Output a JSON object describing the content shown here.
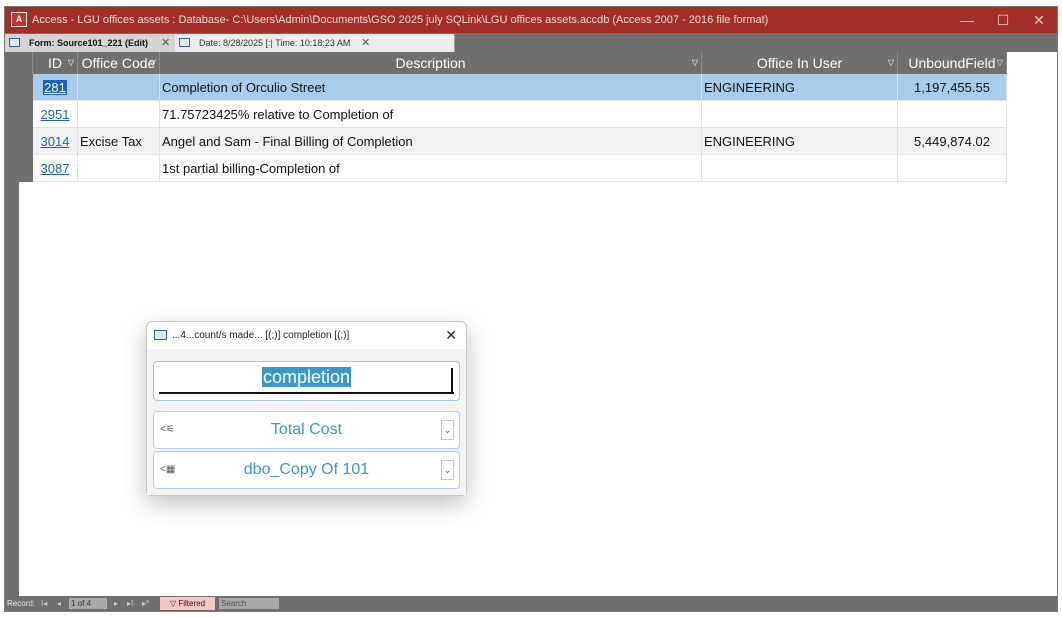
{
  "window": {
    "app_icon_text": "A",
    "title": "Access - LGU offices assets : Database- C:\\Users\\Admin\\Documents\\GSO 2025 july SQLink\\LGU offices assets.accdb (Access 2007 - 2016 file format)",
    "minimize": "—",
    "maximize": "☐",
    "close": "✕"
  },
  "tabs": [
    {
      "label": "Form: Source101_221 (Edit)",
      "close": "✕"
    },
    {
      "label": "Date: 8/28/2025 [:| Time: 10:18:23 AM",
      "close": "✕"
    }
  ],
  "columns": [
    {
      "label": "ID",
      "dropdown": "▽"
    },
    {
      "label": "Office Code",
      "dropdown": "▽"
    },
    {
      "label": "Description",
      "dropdown": "▽"
    },
    {
      "label": "Office In User",
      "dropdown": "▽"
    },
    {
      "label": "UnboundField",
      "dropdown": "▽"
    }
  ],
  "rows": [
    {
      "id": "281",
      "office_code": "",
      "description": "Completion of Orculio Street",
      "office_in_user": "ENGINEERING",
      "unbound": "1,197,455.55"
    },
    {
      "id": "2951",
      "office_code": "",
      "description": "71.75723425% relative to Completion of",
      "office_in_user": "",
      "unbound": ""
    },
    {
      "id": "3014",
      "office_code": "Excise Tax",
      "description": "Angel and Sam - Final Billing of Completion",
      "office_in_user": "ENGINEERING",
      "unbound": "5,449,874.02"
    },
    {
      "id": "3087",
      "office_code": "",
      "description": "1st partial billing-Completion of",
      "office_in_user": "",
      "unbound": ""
    }
  ],
  "status": {
    "record_label": "Record:",
    "nav_first": "I◂",
    "nav_prev": "◂",
    "position": "1 of 4",
    "nav_next": "▸",
    "nav_last": "▸I",
    "nav_new": "▸*",
    "filter_label": "Filtered",
    "search_placeholder": "Search"
  },
  "popup": {
    "title": "...4...count/s made... [(;)] completion [(;)]",
    "close": "✕",
    "search_value": "completion",
    "combo1": {
      "prefix": "<",
      "value": "Total Cost",
      "arrow": "⌄"
    },
    "combo2": {
      "prefix": "<",
      "value": "dbo_Copy Of 101",
      "arrow": "⌄"
    }
  }
}
